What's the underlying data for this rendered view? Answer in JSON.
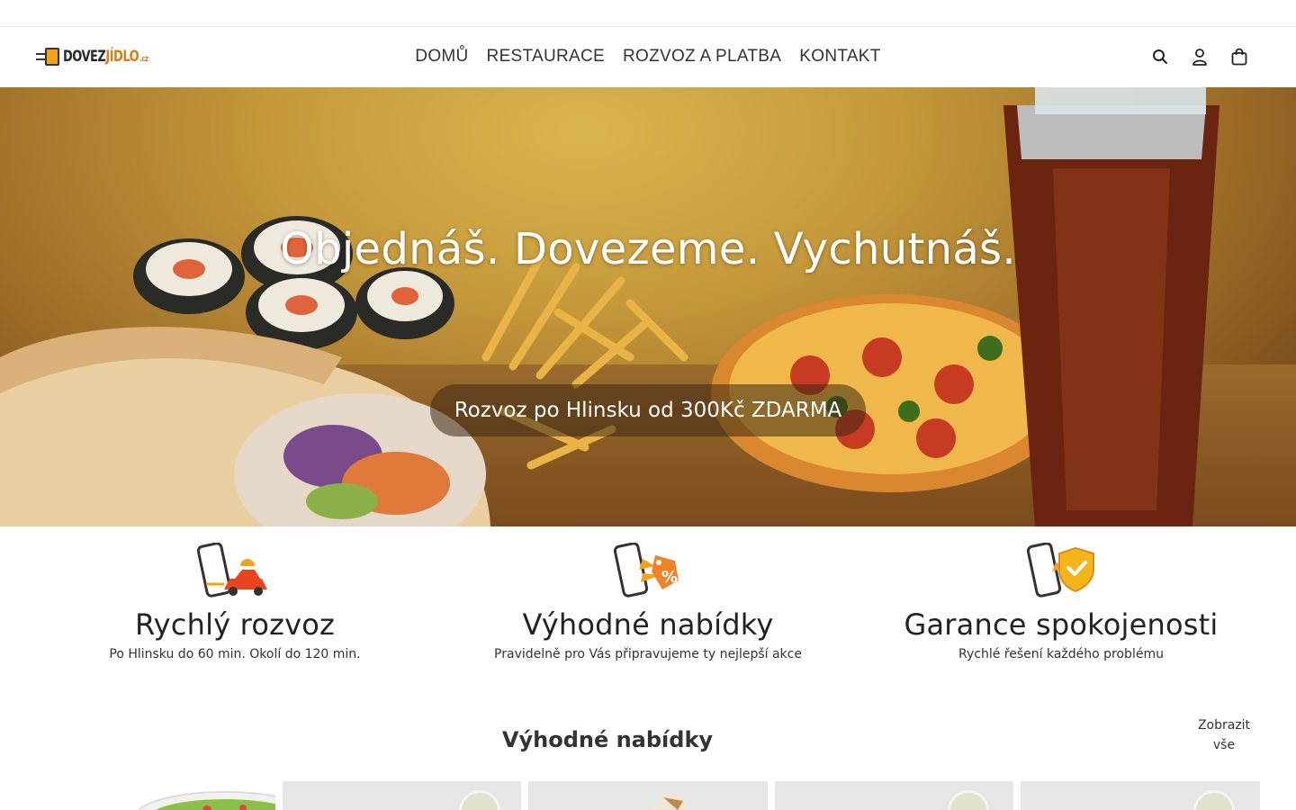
{
  "header": {
    "logo_alt": "DOVEZJÍDLO.cz",
    "logo_part1": "DOVEZ",
    "logo_part2": "JÍDLO",
    "logo_tld": ".cz",
    "nav": [
      {
        "label": "DOMŮ"
      },
      {
        "label": "RESTAURACE"
      },
      {
        "label": "ROZVOZ A PLATBA"
      },
      {
        "label": "KONTAKT"
      }
    ],
    "icons": [
      "search-icon",
      "account-icon",
      "cart-icon"
    ]
  },
  "hero": {
    "headline": "Objednáš. Dovezeme. Vychutnáš.",
    "banner": "Rozvoz po Hlinsku od 300Kč ZDARMA"
  },
  "features": [
    {
      "icon": "phone-car-delivery-icon",
      "title": "Rychlý rozvoz",
      "text": "Po Hlinsku do 60 min. Okolí do 120 min."
    },
    {
      "icon": "phone-discount-icon",
      "title": "Výhodné nabídky",
      "text": "Pravidelně pro Vás připravujeme ty nejlepší akce"
    },
    {
      "icon": "phone-shield-icon",
      "title": "Garance spokojenosti",
      "text": "Rychlé řešení každého problému"
    }
  ],
  "offers": {
    "title": "Výhodné nabídky",
    "show_all_line1": "Zobrazit",
    "show_all_line2": "vše"
  },
  "colors": {
    "accent": "#e0791a",
    "text": "#222222",
    "hero_overlay": "#3c2814"
  }
}
